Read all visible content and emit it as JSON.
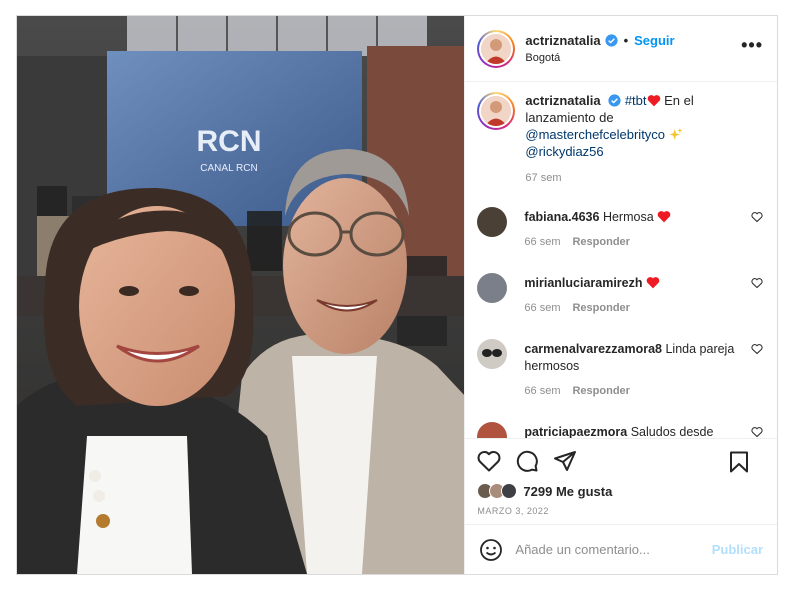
{
  "post": {
    "author": "actriznatalia",
    "follow_label": "Seguir",
    "separator": "•",
    "location": "Bogotá",
    "more_label": "•••",
    "photo_alt": "Selfie en el lanzamiento de MasterChef Celebrity",
    "caption": {
      "hashtag": "#tbt",
      "text": "En el lanzamiento de",
      "mention1": "@masterchefcelebrityco",
      "mention2": "@rickydiaz56",
      "time": "67 sem"
    }
  },
  "comments": [
    {
      "user": "fabiana.4636",
      "text": "Hermosa",
      "heart": true,
      "time": "66 sem",
      "reply": "Responder",
      "avatar_color": "#4b4036"
    },
    {
      "user": "mirianluciaramirezh",
      "text": "",
      "heart": true,
      "time": "66 sem",
      "reply": "Responder",
      "avatar_color": "#7a7f8a"
    },
    {
      "user": "carmenalvarezzamora8",
      "text": "Linda pareja hermosos",
      "heart": false,
      "time": "66 sem",
      "reply": "Responder",
      "avatar_color": "#cfcac4"
    },
    {
      "user": "patriciapaezmora",
      "text": "Saludos desde Pueblo México",
      "heart": false,
      "time": "",
      "reply": "",
      "avatar_color": "#b0543f"
    }
  ],
  "actions": {
    "likes_count": "7299",
    "likes_label": "Me gusta",
    "date": "MARZO 3, 2022",
    "comment_placeholder": "Añade un comentario...",
    "publish_label": "Publicar"
  },
  "photo_sign": {
    "line1": "RCN",
    "line2": "CANAL RCN"
  },
  "colors": {
    "accent": "#0095f6",
    "mention": "#00376b",
    "heart": "#ed4956",
    "muted": "#8e8e8e",
    "verified": "#3897f0"
  },
  "icons": [
    "verified-badge-icon",
    "more-options-icon",
    "heart-icon",
    "comment-icon",
    "share-icon",
    "save-icon",
    "emoji-icon"
  ]
}
